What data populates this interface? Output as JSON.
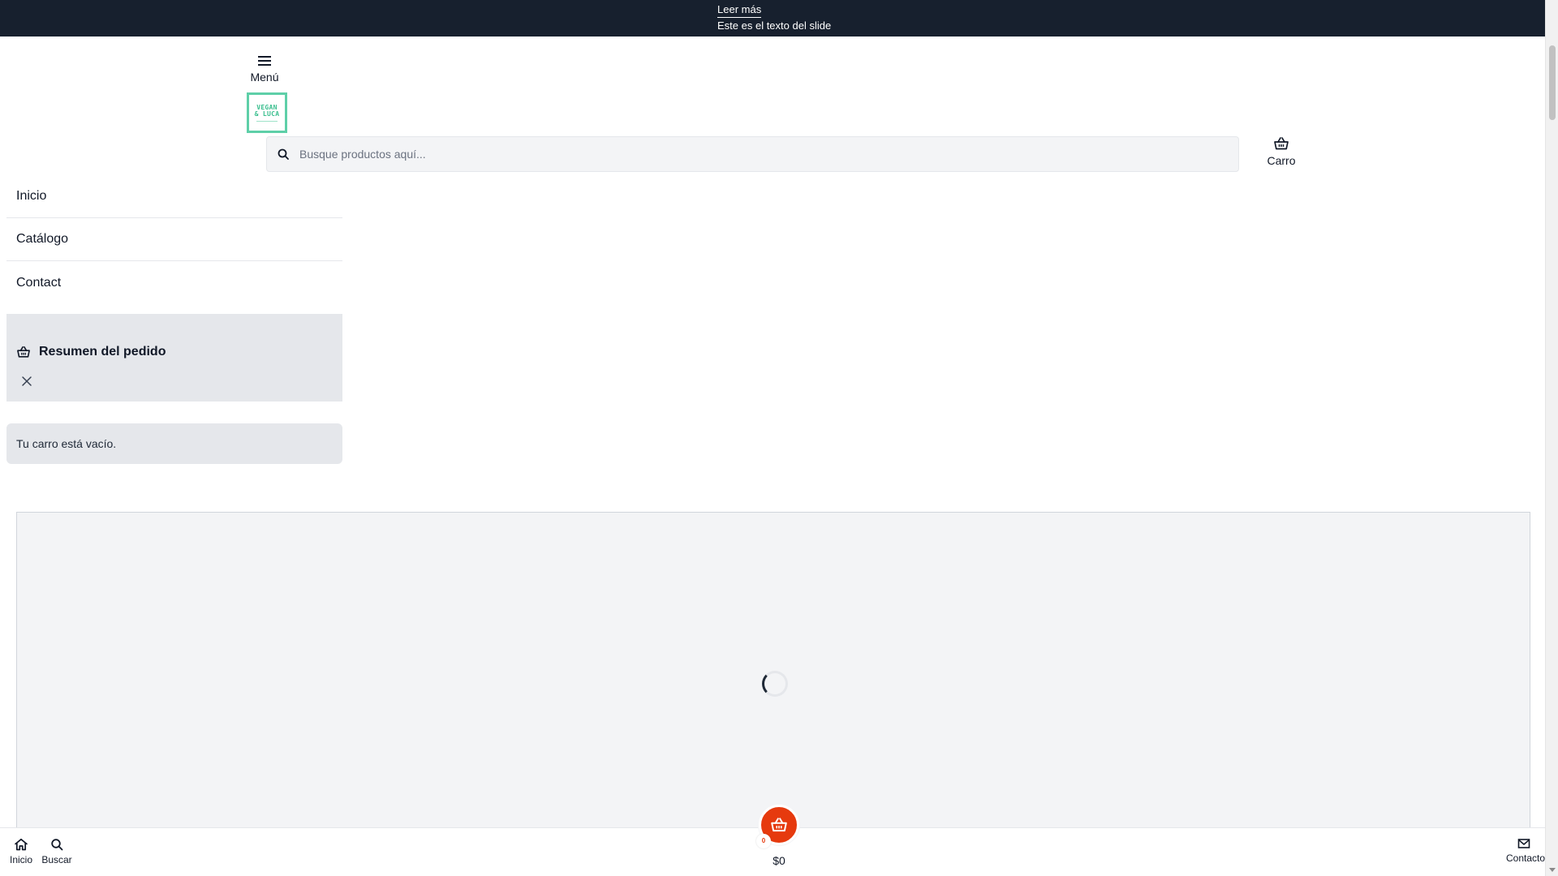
{
  "announcement": {
    "link_label": "Leer más",
    "slide_text": "Este es el texto del slide"
  },
  "header": {
    "menu_label": "Menú",
    "logo_line1": "VEGAN",
    "logo_line2": "& LUCA",
    "search_placeholder": "Busque productos aquí...",
    "cart_label": "Carro"
  },
  "nav": {
    "items": [
      {
        "label": "Inicio"
      },
      {
        "label": "Catálogo"
      },
      {
        "label": "Contact"
      }
    ]
  },
  "order_summary": {
    "title": "Resumen del pedido",
    "empty_message": "Tu carro está vacío."
  },
  "bottom_bar": {
    "home_label": "Inicio",
    "search_label": "Buscar",
    "contact_label": "Contacto",
    "cart_count": "0",
    "cart_total": "$0"
  },
  "colors": {
    "topbar_bg": "#17202e",
    "accent_cart": "#e63a0e",
    "logo_green": "#5ecfa8",
    "panel_gray": "#e5e7eb"
  },
  "icons": {
    "menu": "menu-icon",
    "search": "search-icon",
    "cart": "basket-icon",
    "close": "close-icon",
    "home": "home-icon",
    "mail": "mail-icon"
  }
}
